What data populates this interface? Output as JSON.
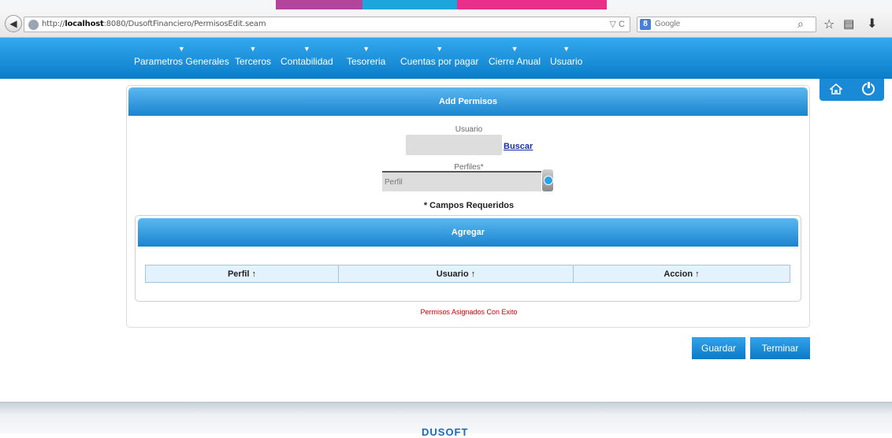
{
  "browser": {
    "url_prefix": "http://",
    "url_host": "localhost",
    "url_rest": ":8080/DusoftFinanciero/PermisosEdit.seam",
    "search_engine": "Google",
    "search_placeholder": "Google"
  },
  "nav": {
    "items": [
      {
        "label": "Parametros Generales"
      },
      {
        "label": "Terceros"
      },
      {
        "label": "Contabilidad"
      },
      {
        "label": "Tesoreria"
      },
      {
        "label": "Cuentas por pagar"
      },
      {
        "label": "Cierre Anual"
      },
      {
        "label": "Usuario"
      }
    ],
    "caret": "▼"
  },
  "form": {
    "title": "Add Permisos",
    "usuario_label": "Usuario",
    "usuario_value": "",
    "buscar_label": "Buscar",
    "perfiles_label": "Perfiles*",
    "perfil_placeholder": "Perfil",
    "required_note": "* Campos Requeridos"
  },
  "agregar": {
    "title": "Agregar",
    "columns": [
      "Perfil ↑",
      "Usuario ↑",
      "Accion ↑"
    ]
  },
  "status": {
    "message": "Permisos Asignados Con Exito"
  },
  "actions": {
    "guardar": "Guardar",
    "terminar": "Terminar"
  },
  "footer": {
    "logo_text": "DUSOFT"
  },
  "colors": {
    "accent": "#0a7dc9",
    "header_gradient_top": "#5bb8f0",
    "success_text": "#d00000"
  }
}
